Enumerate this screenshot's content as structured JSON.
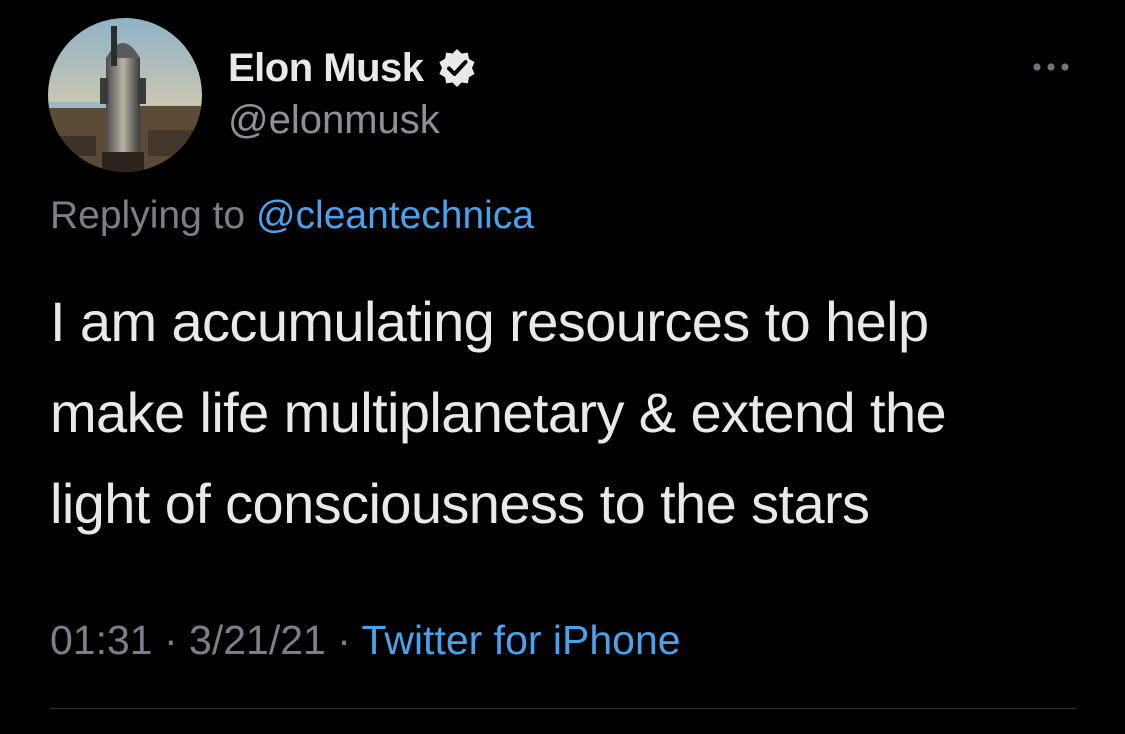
{
  "author": {
    "display_name": "Elon Musk",
    "handle": "@elonmusk",
    "verified": true
  },
  "reply": {
    "prefix": "Replying to ",
    "mention": "@cleantechnica"
  },
  "tweet": {
    "lines": [
      "I am accumulating resources to help",
      "make life multiplanetary & extend the",
      "light of consciousness to the stars"
    ]
  },
  "meta": {
    "time": "01:31",
    "separator": " · ",
    "date": "3/21/21",
    "source": "Twitter for iPhone"
  },
  "icons": {
    "more": "more-options-icon",
    "verified": "verified-badge-icon"
  },
  "colors": {
    "background": "#000000",
    "accent": "#4aa1ec",
    "secondary_text": "#7a8087"
  }
}
